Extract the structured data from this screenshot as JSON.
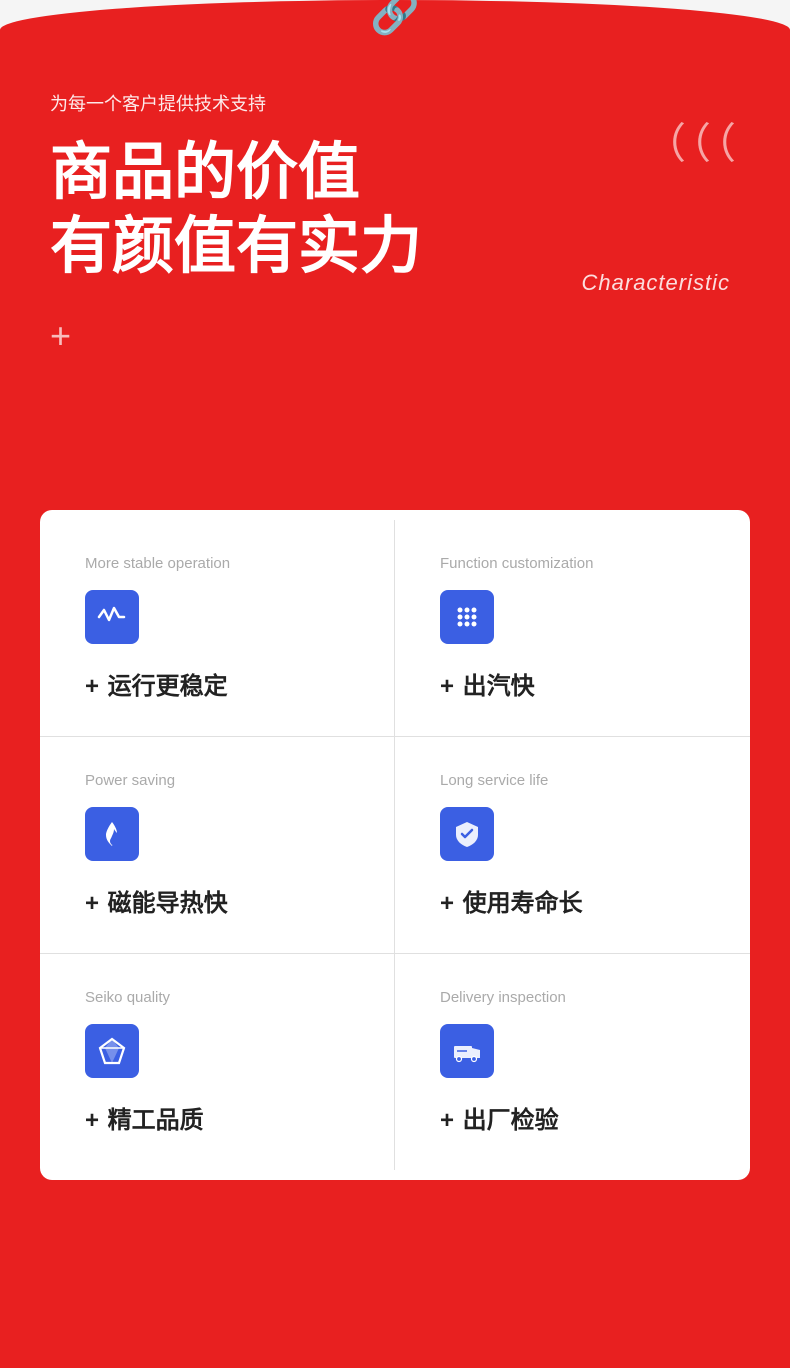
{
  "top": {
    "product_icon": "🔧"
  },
  "hero": {
    "subtitle": "为每一个客户提供技术支持",
    "quote_marks": "（（（",
    "title_line1": "商品的价值",
    "title_line2": "有颜值有实力",
    "characteristic": "Characteristic",
    "plus": "+"
  },
  "features": [
    {
      "label": "More stable operation",
      "icon": "wave",
      "title_plus": "+",
      "title": " 运行更稳定"
    },
    {
      "label": "Function customization",
      "icon": "dots",
      "title_plus": "+",
      "title": " 出汽快"
    },
    {
      "label": "Power saving",
      "icon": "flame",
      "title_plus": "+",
      "title": " 磁能导热快"
    },
    {
      "label": "Long service life",
      "icon": "shield",
      "title_plus": "+",
      "title": " 使用寿命长"
    },
    {
      "label": "Seiko quality",
      "icon": "diamond",
      "title_plus": "+",
      "title": " 精工品质"
    },
    {
      "label": "Delivery inspection",
      "icon": "truck",
      "title_plus": "+",
      "title": " 出厂检验"
    }
  ]
}
